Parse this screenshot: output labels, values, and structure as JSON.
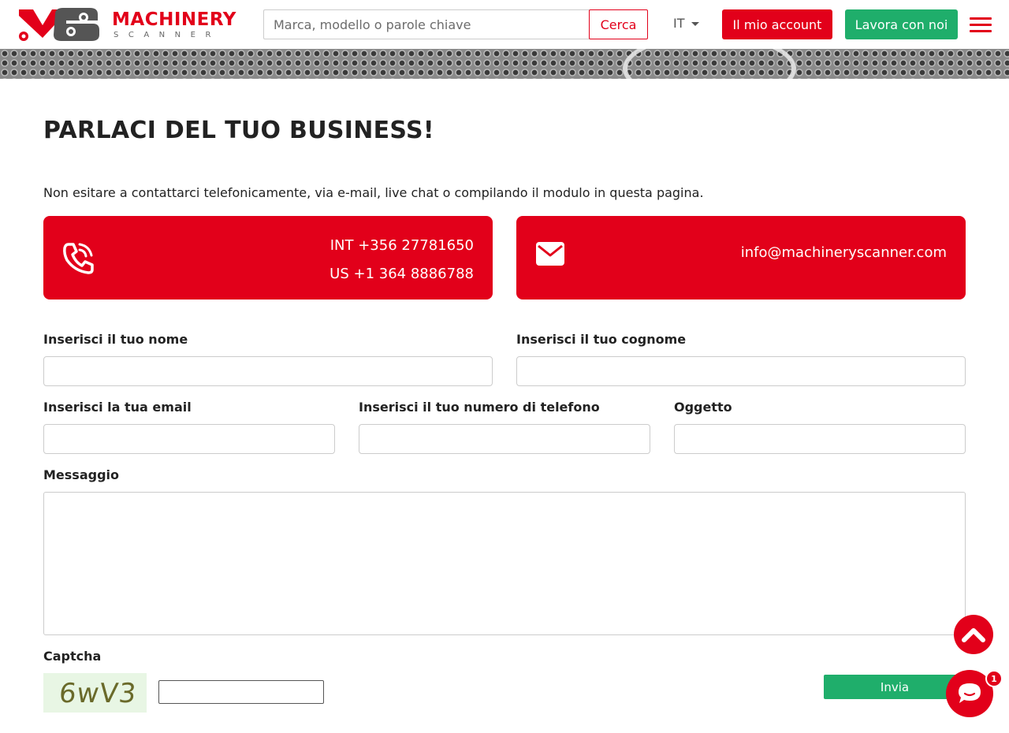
{
  "brand": {
    "name": "MACHINERY",
    "sub": "SCANNER"
  },
  "header": {
    "search_placeholder": "Marca, modello o parole chiave",
    "search_button": "Cerca",
    "language": "IT",
    "account_button": "Il mio account",
    "work_button": "Lavora con noi"
  },
  "main": {
    "title": "PARLACI DEL TUO BUSINESS!",
    "intro": "Non esitare a contattarci telefonicamente, via e-mail, live chat o compilando il modulo in questa pagina.",
    "phone_int": "INT +356 27781650",
    "phone_us": "US +1 364 8886788",
    "email": "info@machineryscanner.com"
  },
  "form": {
    "first_name_label": "Inserisci il tuo nome",
    "last_name_label": "Inserisci il tuo cognome",
    "email_label": "Inserisci la tua email",
    "phone_label": "Inserisci il tuo numero di telefono",
    "subject_label": "Oggetto",
    "message_label": "Messaggio",
    "captcha_label": "Captcha",
    "captcha_text": "6wV3",
    "submit_button": "Invia"
  },
  "chat": {
    "badge_count": "1"
  },
  "colors": {
    "brand_red": "#e2001a",
    "action_green": "#1fae6b"
  }
}
